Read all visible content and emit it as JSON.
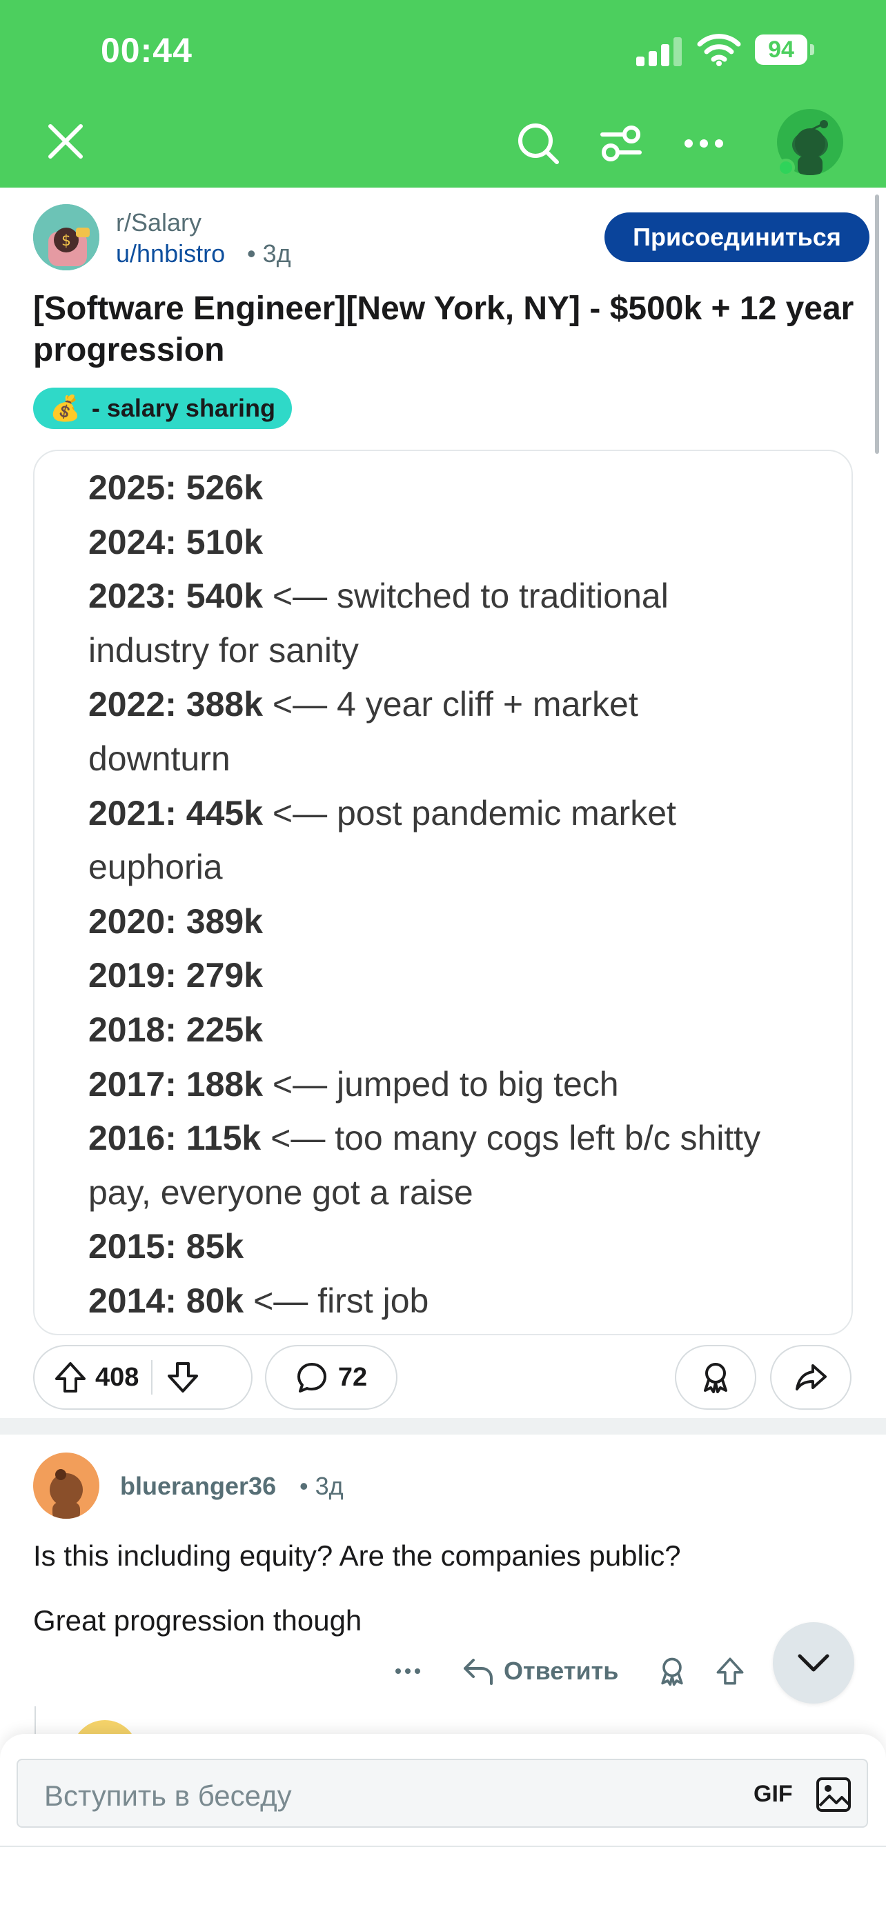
{
  "status_bar": {
    "time": "00:44",
    "battery": "94"
  },
  "header": {
    "close_icon": "close-icon",
    "search_icon": "search-icon",
    "filter_icon": "filter-icon",
    "more_icon": "more-horizontal-icon",
    "avatar": "snoo-avatar"
  },
  "post": {
    "subreddit": "r/Salary",
    "author": "u/hnbistro",
    "time": "• 3д",
    "join_label": "Присоединиться",
    "title": "[Software Engineer][New York, NY] - $500k + 12 year progression",
    "flair_emoji": "💰",
    "flair_text": "- salary sharing",
    "image_lines": [
      {
        "bold": "2025: 526k",
        "rest": ""
      },
      {
        "bold": "2024: 510k",
        "rest": ""
      },
      {
        "bold": "2023: 540k",
        "rest": " <— switched to traditional"
      },
      {
        "bold": "",
        "rest": "industry for sanity"
      },
      {
        "bold": "2022: 388k",
        "rest": " <— 4 year cliff + market"
      },
      {
        "bold": "",
        "rest": "downturn"
      },
      {
        "bold": "2021: 445k",
        "rest": " <— post pandemic market"
      },
      {
        "bold": "",
        "rest": "euphoria"
      },
      {
        "bold": "2020: 389k",
        "rest": ""
      },
      {
        "bold": "2019: 279k",
        "rest": ""
      },
      {
        "bold": "2018: 225k",
        "rest": ""
      },
      {
        "bold": "2017: 188k",
        "rest": " <— jumped to big tech"
      },
      {
        "bold": "2016: 115k",
        "rest": " <— too many cogs left b/c shitty"
      },
      {
        "bold": "",
        "rest": "pay, everyone got a raise"
      },
      {
        "bold": "2015: 85k",
        "rest": ""
      },
      {
        "bold": "2014: 80k",
        "rest": " <— first job"
      }
    ],
    "votes": "408",
    "comments": "72"
  },
  "comment": {
    "user": "blueranger36",
    "time": "• 3д",
    "text_1": "Is this including equity? Are the companies public?",
    "text_2": "Great progression though",
    "reply_label": "Ответить"
  },
  "composer": {
    "placeholder": "Вступить в беседу",
    "gif_label": "GIF"
  },
  "colors": {
    "header_green": "#4ccf5e",
    "join_blue": "#0a449b",
    "flair_teal": "#2fd9c8",
    "username_blue": "#0d4f9e"
  }
}
